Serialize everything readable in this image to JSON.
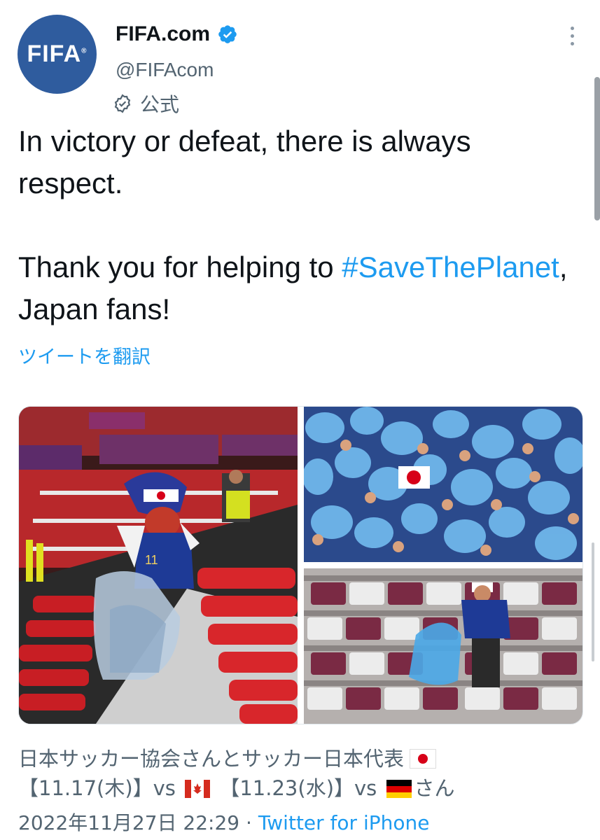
{
  "account": {
    "avatar_text": "FIFA",
    "avatar_mark": "®",
    "name": "FIFA.com",
    "handle": "@FIFAcom",
    "official_label": "公式"
  },
  "tweet": {
    "line1": "In victory or defeat, there is always respect.",
    "line2_prefix": "Thank you for helping to ",
    "hashtag": "#SaveThePlanet",
    "line2_suffix": ", Japan fans!",
    "translate_label": "ツイートを翻訳"
  },
  "media": {
    "image_left": "fan-cleaning-stadium-photo",
    "image_right_top": "fans-waving-blue-bags-photo",
    "image_right_bottom": "fan-collecting-trash-photo",
    "left_jersey_number": "11"
  },
  "caption": {
    "line1": "日本サッカー協会さんとサッカー日本代表",
    "date1": "【11.17(木)】vs",
    "date2": "【11.23(水)】vs",
    "suffix": "さん"
  },
  "meta": {
    "timestamp": "2022年11月27日 22:29",
    "separator": " · ",
    "client": "Twitter for iPhone"
  },
  "colors": {
    "accent": "#1d9bf0",
    "secondary_text": "#536471",
    "avatar_bg": "#2f5c9e"
  }
}
